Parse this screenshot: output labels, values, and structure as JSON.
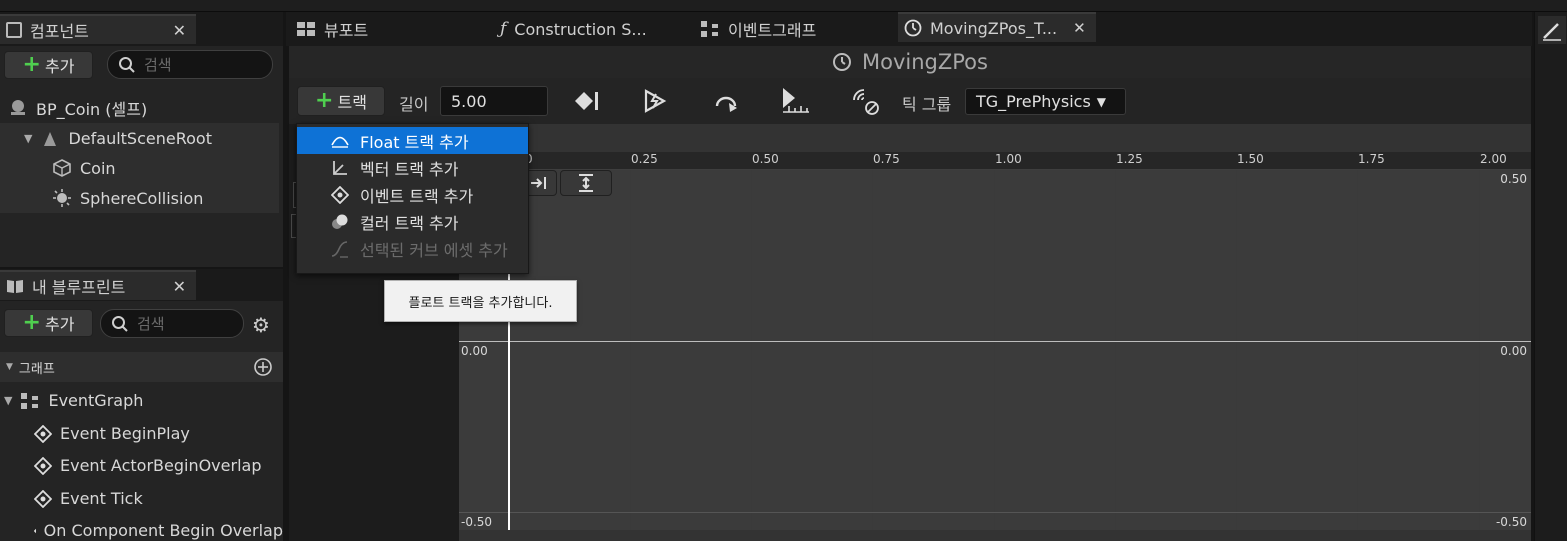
{
  "left": {
    "components_tab": "컴포넌트",
    "add_label": "추가",
    "search_placeholder": "검색",
    "tree": {
      "root": "BP_Coin (셀프)",
      "scene_root": "DefaultSceneRoot",
      "coin": "Coin",
      "sphere": "SphereCollision"
    },
    "blueprint_tab": "내 블루프린트",
    "graph_section": "그래프",
    "event_graph": "EventGraph",
    "events": [
      "Event BeginPlay",
      "Event ActorBeginOverlap",
      "Event Tick",
      "On Component Begin Overlap"
    ]
  },
  "tabs": {
    "viewport": "뷰포트",
    "construction": "Construction S...",
    "eventgraph": "이벤트그래프",
    "timeline": "MovingZPos_T..."
  },
  "timeline": {
    "title": "MovingZPos",
    "track_button": "트랙",
    "length_label": "길이",
    "length_value": "5.00",
    "tick_group_label": "틱 그룹",
    "tick_group_value": "TG_PrePhysics",
    "x_ticks": [
      "0",
      "0.25",
      "0.50",
      "0.75",
      "1.00",
      "1.25",
      "1.50",
      "1.75",
      "2.00"
    ],
    "y_top": "0.50",
    "y_mid": "0.00",
    "y_bottom": "-0.50"
  },
  "menu": {
    "items": [
      "Float 트랙 추가",
      "벡터 트랙 추가",
      "이벤트 트랙 추가",
      "컬러 트랙 추가",
      "선택된 커브 에셋 추가"
    ]
  },
  "tooltip": "플로트 트랙을 추가합니다.",
  "colors": {
    "accent": "#0e72d6",
    "add_green": "#4fcf4f"
  }
}
